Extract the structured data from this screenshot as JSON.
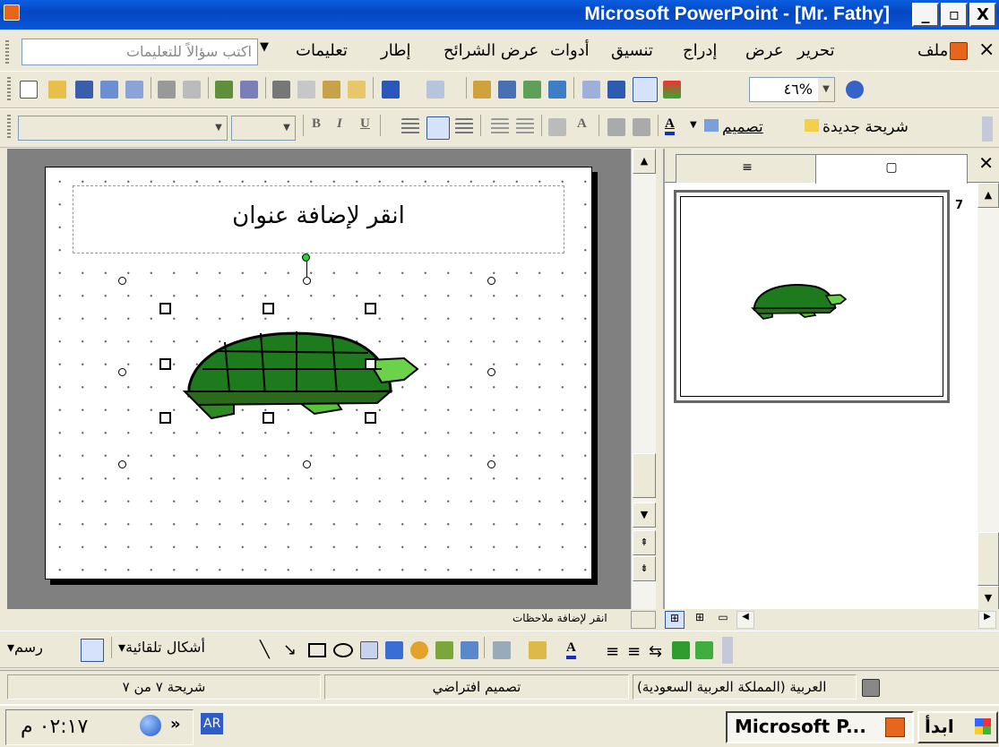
{
  "window": {
    "title": "Microsoft PowerPoint - [Mr. Fathy]",
    "minimize": "_",
    "restore": "▫",
    "close": "X"
  },
  "menubar": {
    "close_doc": "×",
    "items": [
      "ملف",
      "تحرير",
      "عرض",
      "إدراج",
      "تنسيق",
      "أدوات",
      "عرض الشرائح",
      "إطار",
      "تعليمات"
    ],
    "ask_placeholder": "اكتب سؤالاً للتعليمات"
  },
  "standard_toolbar": {
    "zoom": "٤٦%"
  },
  "formatting_toolbar": {
    "font_name": "",
    "font_size": "",
    "new_slide": "شريحة جديدة",
    "design": "تصميم"
  },
  "slide": {
    "title_placeholder": "انقر لإضافة عنوان",
    "image": "turtle-clipart"
  },
  "pane": {
    "tab_outline": "outline-icon",
    "tab_slides": "slides-icon",
    "close": "✕",
    "slide_number": "7"
  },
  "notes": {
    "placeholder": "انقر لإضافة ملاحظات"
  },
  "drawing_toolbar": {
    "draw": "رسم",
    "autoshapes": "أشكال تلقائية"
  },
  "statusbar": {
    "slide_position": "شريحة ٧ من ٧",
    "design_name": "تصميم افتراضي",
    "language": "العربية (المملكة العربية السعودية)"
  },
  "taskbar": {
    "start": "ابدأ",
    "app_button": "Microsoft P...",
    "language_indicator": "AR",
    "clock": "٠٢:١٧ م"
  }
}
